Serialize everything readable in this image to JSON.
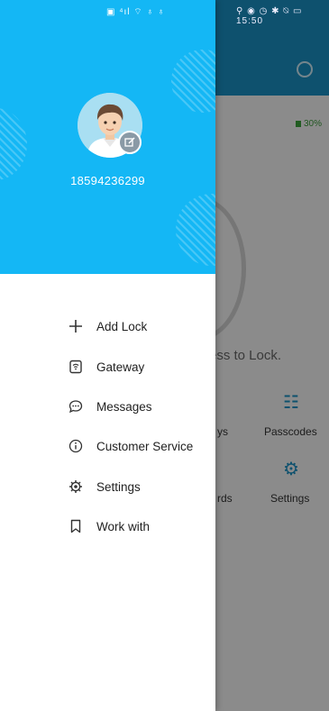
{
  "status_bar": {
    "left_icons": "▣ ⁴ıl ⌔ ♁ ♁",
    "right_text": "⚲ ◉ ◷ ✱ ⍉ ▭ 15:50"
  },
  "background": {
    "battery_text": "30%",
    "press_text": "ess to Lock.",
    "grid": [
      {
        "label": "ys",
        "icon": ""
      },
      {
        "label": "Passcodes",
        "icon": "☷"
      },
      {
        "label": "rds",
        "icon": ""
      },
      {
        "label": "Settings",
        "icon": "⚙"
      }
    ]
  },
  "drawer": {
    "phone_number": "18594236299",
    "menu": [
      {
        "label": "Add Lock",
        "icon": "plus-icon"
      },
      {
        "label": "Gateway",
        "icon": "gateway-icon"
      },
      {
        "label": "Messages",
        "icon": "message-icon"
      },
      {
        "label": "Customer Service",
        "icon": "info-icon"
      },
      {
        "label": "Settings",
        "icon": "gear-icon"
      },
      {
        "label": "Work with",
        "icon": "bookmark-icon"
      }
    ]
  },
  "colors": {
    "drawer_header": "#14b7f5",
    "app_header": "#1a8fc2"
  }
}
